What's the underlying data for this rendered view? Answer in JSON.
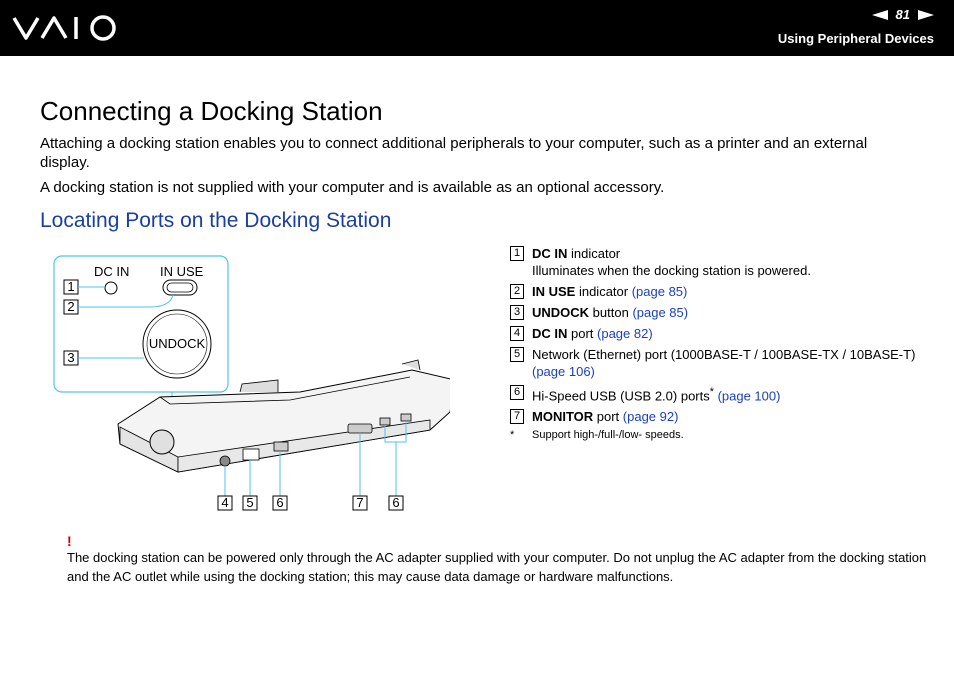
{
  "header": {
    "brand": "VAIO",
    "page_number": "81",
    "section_title": "Using Peripheral Devices"
  },
  "title": "Connecting a Docking Station",
  "intro": [
    "Attaching a docking station enables you to connect additional peripherals to your computer, such as a printer and an external display.",
    "A docking station is not supplied with your computer and is available as an optional accessory."
  ],
  "subtitle": "Locating Ports on the Docking Station",
  "figure": {
    "dc_in_label": "DC IN",
    "in_use_label": "IN USE",
    "undock_label": "UNDOCK",
    "callouts_inset": [
      "1",
      "2",
      "3"
    ],
    "callouts_bottom": [
      "4",
      "5",
      "6",
      "7",
      "6"
    ]
  },
  "legend": [
    {
      "num": "1",
      "bold": "DC IN",
      "text": " indicator",
      "sub": "Illuminates when the docking station is powered."
    },
    {
      "num": "2",
      "bold": "IN USE",
      "text": " indicator ",
      "link": "(page 85)"
    },
    {
      "num": "3",
      "bold": "UNDOCK",
      "text": " button ",
      "link": "(page 85)"
    },
    {
      "num": "4",
      "bold": "DC IN",
      "text": " port ",
      "link": "(page 82)"
    },
    {
      "num": "5",
      "bold": "",
      "text": "Network (Ethernet) port (1000BASE-T / 100BASE-TX / 10BASE-T) ",
      "link": "(page 106)"
    },
    {
      "num": "6",
      "bold": "",
      "text": "Hi-Speed USB (USB 2.0) ports",
      "sup": "*",
      "link": " (page 100)"
    },
    {
      "num": "7",
      "bold": "MONITOR",
      "text": " port ",
      "link": "(page 92)"
    }
  ],
  "footnote": {
    "mark": "*",
    "text": "Support high-/full-/low- speeds."
  },
  "note": {
    "mark": "!",
    "text": "The docking station can be powered only through the AC adapter supplied with your computer. Do not unplug the AC adapter from the docking station and the AC outlet while using the docking station; this may cause data damage or hardware malfunctions."
  }
}
